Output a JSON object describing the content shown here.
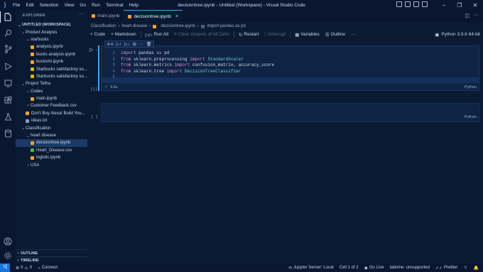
{
  "window": {
    "title": "decisiontree.ipynb - Untitled (Workspace) - Visual Studio Code",
    "menu": [
      "File",
      "Edit",
      "Selection",
      "View",
      "Go",
      "Run",
      "Terminal",
      "Help"
    ]
  },
  "activity_bar": [
    "files-icon",
    "search-icon",
    "source-control-icon",
    "run-debug-icon",
    "remote-explorer-icon",
    "extensions-icon",
    "testing-icon",
    "database-icon",
    "account-icon",
    "settings-icon"
  ],
  "sidebar": {
    "title": "EXPLORER",
    "workspace": "UNTITLED (WORKSPACE)",
    "tree": [
      {
        "label": "Product Analysis",
        "depth": 1,
        "type": "folder",
        "open": true
      },
      {
        "label": "starbucks",
        "depth": 2,
        "type": "folder",
        "open": true
      },
      {
        "label": "analysis.ipynb",
        "depth": 3,
        "type": "notebook"
      },
      {
        "label": "bucks analysis.ipynb",
        "depth": 3,
        "type": "notebook"
      },
      {
        "label": "bucksml.ipynb",
        "depth": 3,
        "type": "notebook"
      },
      {
        "label": "Starbucks satisfactory su...",
        "depth": 3,
        "type": "dataset"
      },
      {
        "label": "Starbucks satisfactory su...",
        "depth": 3,
        "type": "dataset"
      },
      {
        "label": "Project Tetha",
        "depth": 1,
        "type": "folder",
        "open": true
      },
      {
        "label": "Codes",
        "depth": 2,
        "type": "folder",
        "open": true
      },
      {
        "label": "main.ipynb",
        "depth": 3,
        "type": "notebook"
      },
      {
        "label": "Customer Feedback.csv",
        "depth": 2,
        "type": "folder",
        "open": false
      },
      {
        "label": "Don't Buy Alexa! Build You...",
        "depth": 2,
        "type": "notebook"
      },
      {
        "label": "ideas.txt",
        "depth": 2,
        "type": "text"
      },
      {
        "label": "Classification",
        "depth": 1,
        "type": "folder",
        "open": true
      },
      {
        "label": "heart disease",
        "depth": 2,
        "type": "folder",
        "open": true
      },
      {
        "label": "decisiontree.ipynb",
        "depth": 3,
        "type": "notebook",
        "selected": true
      },
      {
        "label": "Heart_Disease.csv",
        "depth": 3,
        "type": "csv"
      },
      {
        "label": "logistic.ipynb",
        "depth": 3,
        "type": "notebook"
      },
      {
        "label": "USA",
        "depth": 2,
        "type": "folder",
        "open": false
      }
    ],
    "outline_label": "OUTLINE",
    "timeline_label": "TIMELINE"
  },
  "tabs": [
    {
      "label": "main.ipynb",
      "active": false
    },
    {
      "label": "decisiontree.ipynb",
      "active": true
    }
  ],
  "breadcrumbs": [
    "Classification",
    "heart disease",
    "decisiontree.ipynb",
    "import pandas as pd"
  ],
  "notebook_toolbar": {
    "code": "Code",
    "markdown": "Markdown",
    "run_all": "Run All",
    "clear_outputs": "Clear Outputs of All Cells",
    "restart": "Restart",
    "interrupt": "Interrupt",
    "variables": "Variables",
    "outline": "Outline",
    "kernel": "Python 3.9.6 64-bit"
  },
  "cells": [
    {
      "exec_count": "[1]",
      "lines": [
        {
          "n": "1",
          "tokens": [
            [
              "kw",
              "import"
            ],
            [
              "txt",
              " pandas "
            ],
            [
              "kw",
              "as"
            ],
            [
              "txt",
              " pd"
            ]
          ]
        },
        {
          "n": "2",
          "tokens": [
            [
              "kw",
              "from"
            ],
            [
              "txt",
              " sklearn.preprocessing "
            ],
            [
              "kw",
              "import"
            ],
            [
              "mod",
              " StandardScaler"
            ]
          ]
        },
        {
          "n": "3",
          "tokens": [
            [
              "kw",
              "from"
            ],
            [
              "txt",
              " sklearn.metrics "
            ],
            [
              "kw",
              "import"
            ],
            [
              "txt",
              " confusion_matrix, accuracy_score"
            ]
          ]
        },
        {
          "n": "4",
          "tokens": [
            [
              "kw",
              "from"
            ],
            [
              "txt",
              " sklearn.tree "
            ],
            [
              "kw",
              "import"
            ],
            [
              "mod",
              " DecisionTreeClassifier"
            ]
          ]
        },
        {
          "n": "5",
          "tokens": []
        }
      ],
      "time": "3.6s",
      "language": "Python"
    },
    {
      "exec_count": "[ ]",
      "lines": [],
      "language": "Python"
    }
  ],
  "statusbar": {
    "errors": "0",
    "warnings": "0",
    "connect": "Connect",
    "jupyter": "Jupyter Server: Local",
    "cell": "Cell 1 of 2",
    "golive": "Go Live",
    "tabnine": "tabnine: unsupported",
    "prettier": "Prettier"
  },
  "colors": {
    "accent": "#3da5f4",
    "background": "#0b1a33",
    "cell_bg": "#0f2345"
  }
}
